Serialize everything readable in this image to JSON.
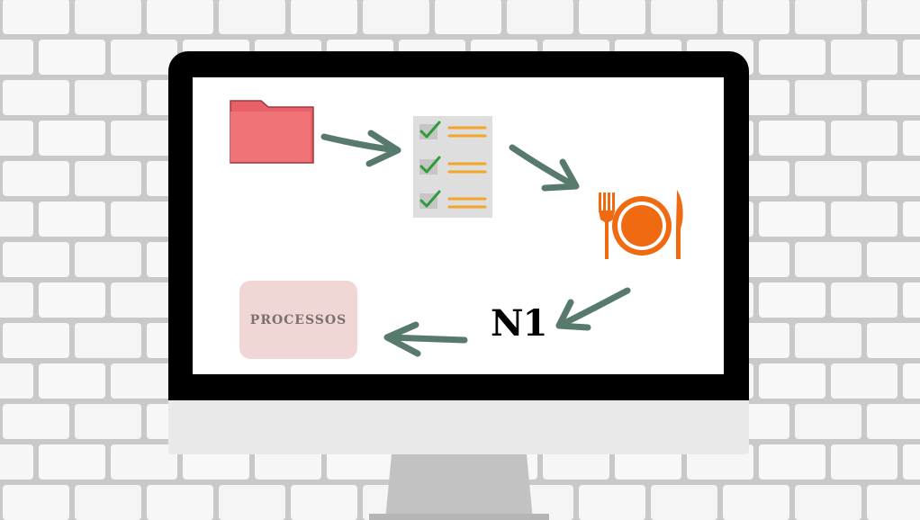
{
  "diagram": {
    "n1_label": "N1",
    "process_label": "PROCESSOS",
    "icons": [
      "folder-icon",
      "checklist-icon",
      "plate-cutlery-icon"
    ],
    "colors": {
      "arrow": "#587a6c",
      "folder": "#f07378",
      "plate": "#ef6a10",
      "check": "#2e9d3c",
      "checklist_lines": "#f4a628",
      "process_box": "#f1d6d6"
    }
  }
}
